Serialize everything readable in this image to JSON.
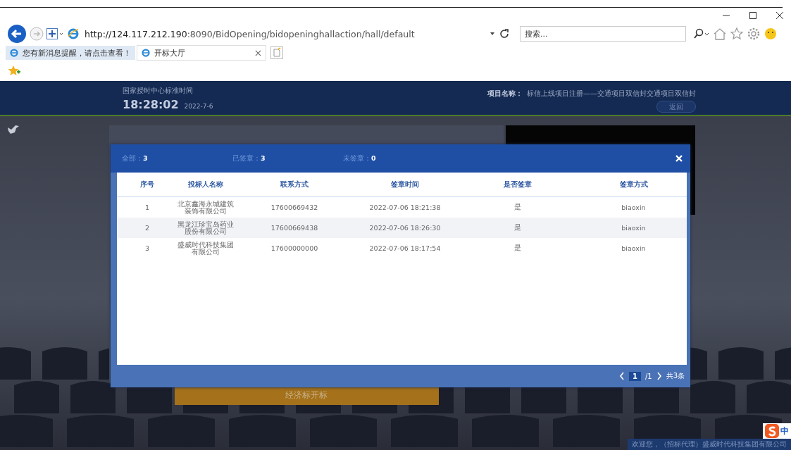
{
  "browser": {
    "url_host": "http://124.117.212.190",
    "url_rest": ":8090/BidOpening/bidopeninghallaction/hall/default",
    "search": {
      "placeholder": "搜索..."
    },
    "tabs": [
      {
        "label": "您有新消息提醒，请点击查看！",
        "selected": false
      },
      {
        "label": "开标大厅",
        "selected": true
      }
    ]
  },
  "header": {
    "clock_label": "国家授时中心标准时间",
    "time": "18:28:02",
    "date": "2022-7-6",
    "project_label": "项目名称：",
    "project_name": "标信上线项目注册——交通项目双信封交通项目双信封",
    "back_button": "返回"
  },
  "hall": {
    "open_button": "经济标开标",
    "welcome": "欢迎您，（招标代理）盛威时代科技集团有限公司"
  },
  "dialog": {
    "counts": [
      {
        "label": "全部：",
        "value": "3"
      },
      {
        "label": "已签章：",
        "value": "3"
      },
      {
        "label": "未签章：",
        "value": "0"
      }
    ],
    "table": {
      "columns": [
        "序号",
        "投标人名称",
        "联系方式",
        "签章时间",
        "是否签章",
        "签章方式"
      ],
      "rows": [
        [
          "1",
          "北京鑫海永城建筑装饰有限公司",
          "17600669432",
          "2022-07-06 18:21:38",
          "是",
          "biaoxin"
        ],
        [
          "2",
          "黑龙江珍宝岛药业股份有限公司",
          "17600669438",
          "2022-07-06 18:26:30",
          "是",
          "biaoxin"
        ],
        [
          "3",
          "盛威时代科技集团有限公司",
          "17600000000",
          "2022-07-06 18:17:54",
          "是",
          "biaoxin"
        ]
      ]
    },
    "pagination": {
      "current": "1",
      "total": "/1",
      "count": "共3条"
    }
  },
  "ime": {
    "label": "中"
  }
}
